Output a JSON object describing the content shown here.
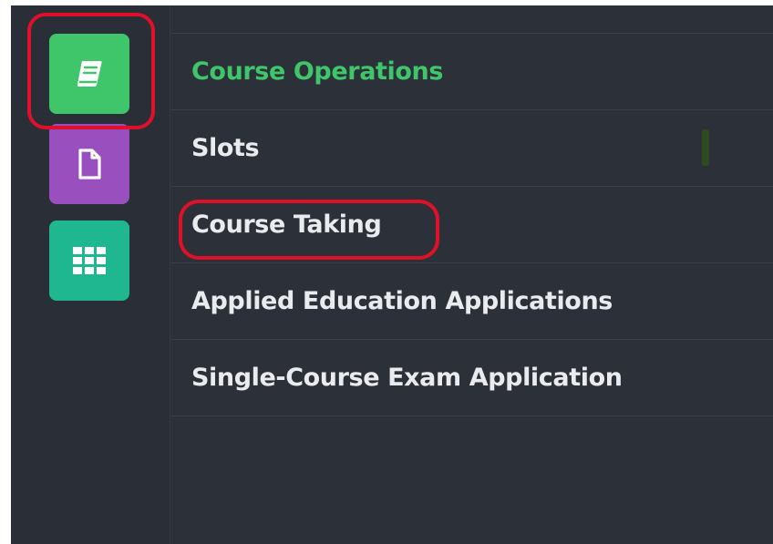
{
  "colors": {
    "accent_green": "#3fc66b",
    "highlight_red": "#e0102a",
    "book_button": "#3fc66b",
    "doc_button": "#9a4fbf",
    "grid_button": "#1fb78f"
  },
  "rail": {
    "buttons": [
      {
        "icon": "book-icon",
        "active": true
      },
      {
        "icon": "document-icon",
        "active": false
      },
      {
        "icon": "grid-icon",
        "active": false
      }
    ]
  },
  "menu": {
    "items": [
      {
        "label": "Course Operations",
        "active": true
      },
      {
        "label": "Slots",
        "active": false
      },
      {
        "label": "Course Taking",
        "active": false
      },
      {
        "label": "Applied Education Applications",
        "active": false
      },
      {
        "label": "Single-Course Exam Application",
        "active": false
      }
    ]
  }
}
